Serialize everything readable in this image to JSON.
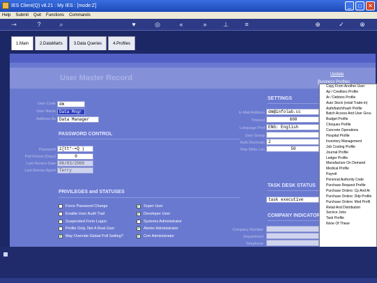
{
  "window": {
    "title": "IES Client(Q) v8.21 : My IES :       [mode:Z]"
  },
  "menubar": [
    "Help",
    "Submit",
    "Quit",
    "Functions",
    "Commands"
  ],
  "tabs": [
    {
      "label": "1.Main"
    },
    {
      "label": "2.DataMarts"
    },
    {
      "label": "3.Data Queries"
    },
    {
      "label": "4.Profiles"
    }
  ],
  "page": {
    "title": "User Master Record",
    "update_link": "Update",
    "business_profiles_link": "Business Profiles"
  },
  "user": {
    "user_code_label": "User Code",
    "user_code": "dm",
    "user_name_label": "User Name",
    "user_name": "Data Mngr",
    "address_as_label": "Address As",
    "address_as": "Data Manager"
  },
  "password": {
    "section": "PASSWORD CONTROL",
    "password_label": "Password",
    "password": "z[tt*-=Q )",
    "poll_period_label": "Poll Period (Days)",
    "poll_period": "0",
    "last_renew_label": "Last Renew Date",
    "last_renew": "06/03/2009",
    "last_renew_agent_label": "Last Renew Agent",
    "last_renew_agent": "Terry"
  },
  "privileges": {
    "section": "PRIVILEGES and STATUSES",
    "left": [
      {
        "label": "Force Password Change",
        "checked": false
      },
      {
        "label": "Enable User Audit Trail",
        "checked": false
      },
      {
        "label": "Suspended From Logon",
        "checked": false
      },
      {
        "label": "Profile Only, Not A Real User",
        "checked": false
      },
      {
        "label": "May Override Global Poll Setting?",
        "checked": true
      }
    ],
    "right": [
      {
        "label": "Super User",
        "checked": true
      },
      {
        "label": "Developer User",
        "checked": true
      },
      {
        "label": "Systems Administrator",
        "checked": false
      },
      {
        "label": "Alerter Administrator",
        "checked": true
      },
      {
        "label": "Crm Administrator",
        "checked": true
      }
    ]
  },
  "settings": {
    "section": "SETTINGS",
    "email_label": "E-Mail Address",
    "email": "dm@infolab.cc",
    "timeout_label": "Timeout",
    "timeout": "600",
    "language_label": "Language Pref",
    "language": "ENG: English",
    "user_group_label": "User Group",
    "user_group": "",
    "auth_decimals_label": "Auth Decimals",
    "auth_decimals": "2",
    "rep_width_label": "Rep Wide Len",
    "rep_width": "50"
  },
  "task_desk": {
    "section": "TASK DESK STATUS",
    "status": "task executive"
  },
  "company": {
    "section": "COMPANY INDICATOR",
    "company_number_label": "Company Number",
    "department_label": "Department",
    "telephone_label": "Telephone"
  },
  "context_menu": [
    "Copy From Another User",
    "Ap / Creditors Profile",
    "Ar / Debtors Profile",
    "Auto Stock (retail Trade-in)",
    "Auth/batch/hash Profile",
    "Batch Access And User Grou",
    "Budget Profile",
    "Cheques Profile",
    "Concrete Operations",
    "Hospital Profile",
    "Inventory Management",
    "Job Costing Profile",
    "Journal Profile",
    "Ledger Profile",
    "Manufacture On Demand",
    "Medical Profile",
    "Payroll",
    "Personal Authority Code",
    "Purchase Request Profile",
    "Purchase Orders: Cp And Ar",
    "Purchase Orders: Ddp Profile",
    "Purchase Orders: Mod Profil",
    "Retail And Distribution",
    "Service Jobs",
    "Task Profile",
    "None Of These"
  ]
}
